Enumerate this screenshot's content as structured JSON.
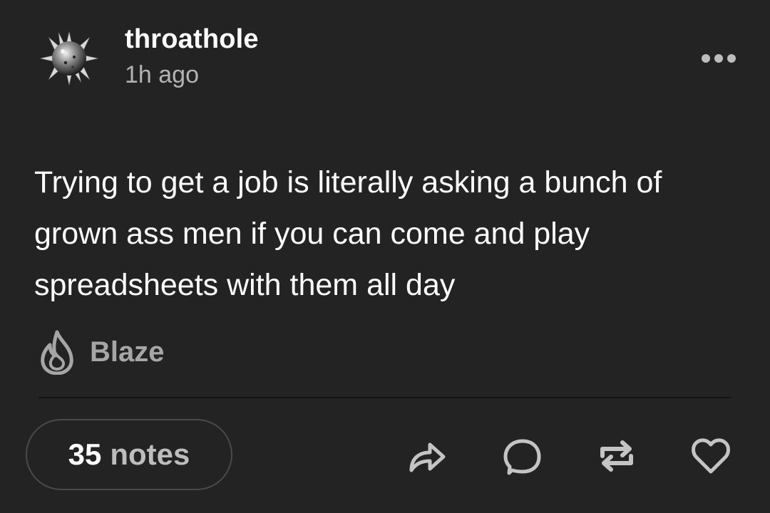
{
  "post": {
    "username": "throathole",
    "timestamp": "1h ago",
    "body": "Trying to get a job is literally asking a bunch of grown ass men if you can come and play spreadsheets with them all day"
  },
  "blaze": {
    "label": "Blaze",
    "icon": "flame-icon"
  },
  "footer": {
    "notes_count": "35",
    "notes_label": "notes",
    "actions": [
      "share-icon",
      "comment-icon",
      "reblog-icon",
      "heart-icon"
    ]
  },
  "colors": {
    "background": "#232323",
    "text_primary": "#ffffff",
    "text_secondary": "#b3b3b3",
    "icon": "#c4c4c4"
  }
}
